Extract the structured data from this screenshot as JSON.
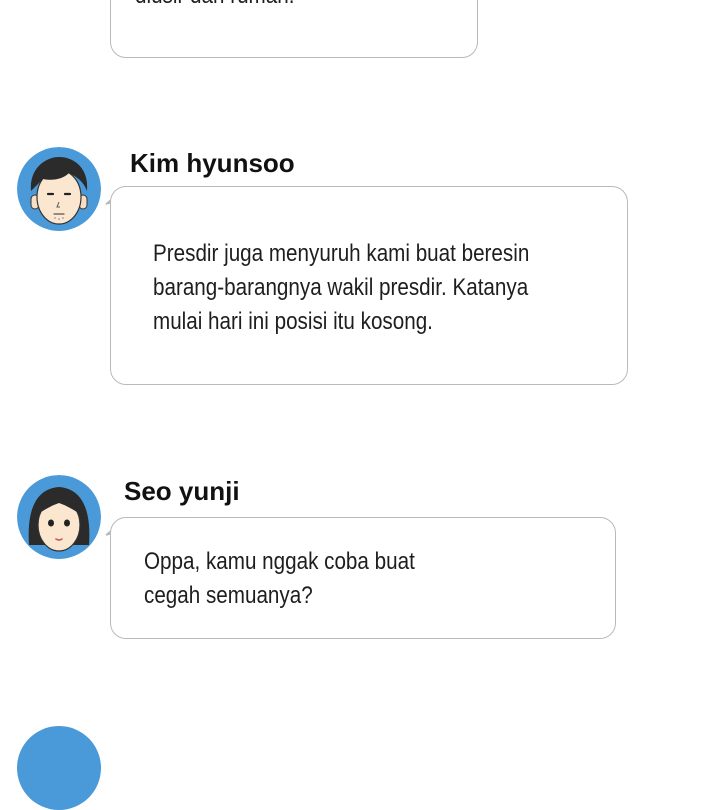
{
  "messages": [
    {
      "text": "diusir dari rumah."
    },
    {
      "sender": "Kim hyunsoo",
      "avatar_icon": "man-avatar-icon",
      "avatar_bg": "#4a9ad9",
      "text": "Presdir juga menyuruh kami buat beresin\nbarang-barangnya wakil presdir. Katanya\nmulai hari ini posisi itu kosong."
    },
    {
      "sender": "Seo yunji",
      "avatar_icon": "woman-avatar-icon",
      "avatar_bg": "#4a9ad9",
      "text": "Oppa, kamu nggak coba buat\ncegah semuanya?"
    }
  ],
  "colors": {
    "bubble_border": "#b9b9b9",
    "avatar_bg": "#4a9ad9",
    "text": "#1e1e1e"
  }
}
